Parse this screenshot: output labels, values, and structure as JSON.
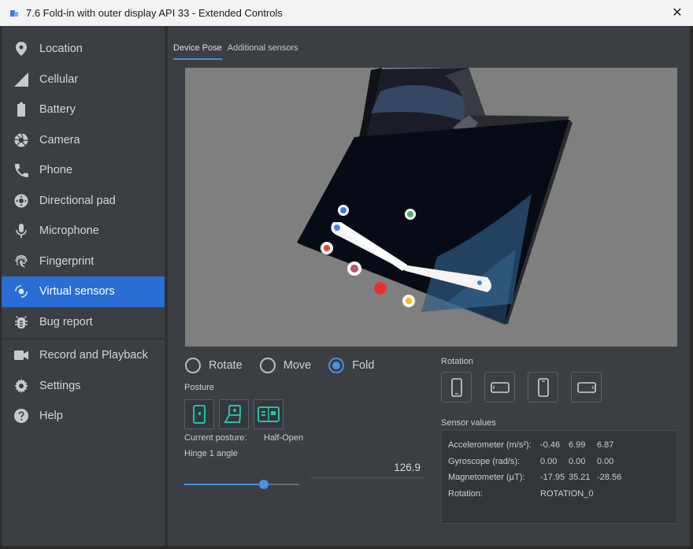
{
  "window": {
    "title": "7.6  Fold-in with outer display API 33 - Extended Controls",
    "close_glyph": "✕"
  },
  "sidebar": {
    "items": [
      {
        "label": "Location",
        "icon": "location-pin-icon"
      },
      {
        "label": "Cellular",
        "icon": "cellular-signal-icon"
      },
      {
        "label": "Battery",
        "icon": "battery-icon"
      },
      {
        "label": "Camera",
        "icon": "camera-aperture-icon"
      },
      {
        "label": "Phone",
        "icon": "phone-icon"
      },
      {
        "label": "Directional pad",
        "icon": "dpad-icon"
      },
      {
        "label": "Microphone",
        "icon": "microphone-icon"
      },
      {
        "label": "Fingerprint",
        "icon": "fingerprint-icon"
      },
      {
        "label": "Virtual sensors",
        "icon": "virtual-sensors-icon",
        "active": true
      },
      {
        "label": "Bug report",
        "icon": "bug-icon"
      }
    ],
    "items2": [
      {
        "label": "Record and Playback",
        "icon": "video-camera-icon"
      },
      {
        "label": "Settings",
        "icon": "gear-icon"
      },
      {
        "label": "Help",
        "icon": "help-icon"
      }
    ]
  },
  "tabs": [
    {
      "label": "Device Pose",
      "active": true
    },
    {
      "label": "Additional sensors",
      "active": false
    }
  ],
  "mode": {
    "rotate": "Rotate",
    "move": "Move",
    "fold": "Fold",
    "selected": "Fold"
  },
  "posture": {
    "label": "Posture",
    "current_label": "Current posture:",
    "current_value": "Half-Open"
  },
  "hinge": {
    "label": "Hinge 1 angle",
    "value": "126.9",
    "slider_fraction": 0.69
  },
  "rotation": {
    "label": "Rotation"
  },
  "sensors": {
    "label": "Sensor values",
    "rows": [
      {
        "name": "Accelerometer (m/s²):",
        "values": [
          "-0.46",
          "6.99",
          "6.87"
        ]
      },
      {
        "name": "Gyroscope (rad/s):",
        "values": [
          "0.00",
          "0.00",
          "0.00"
        ]
      },
      {
        "name": "Magnetometer (µT):",
        "values": [
          "-17.95",
          "35.21",
          "-28.56"
        ]
      },
      {
        "name": "Rotation:",
        "values": [
          "ROTATION_0"
        ]
      }
    ]
  },
  "colors": {
    "accent": "#2a6dd4",
    "teal": "#22c3a6",
    "radio_on": "#4a8fe0"
  }
}
